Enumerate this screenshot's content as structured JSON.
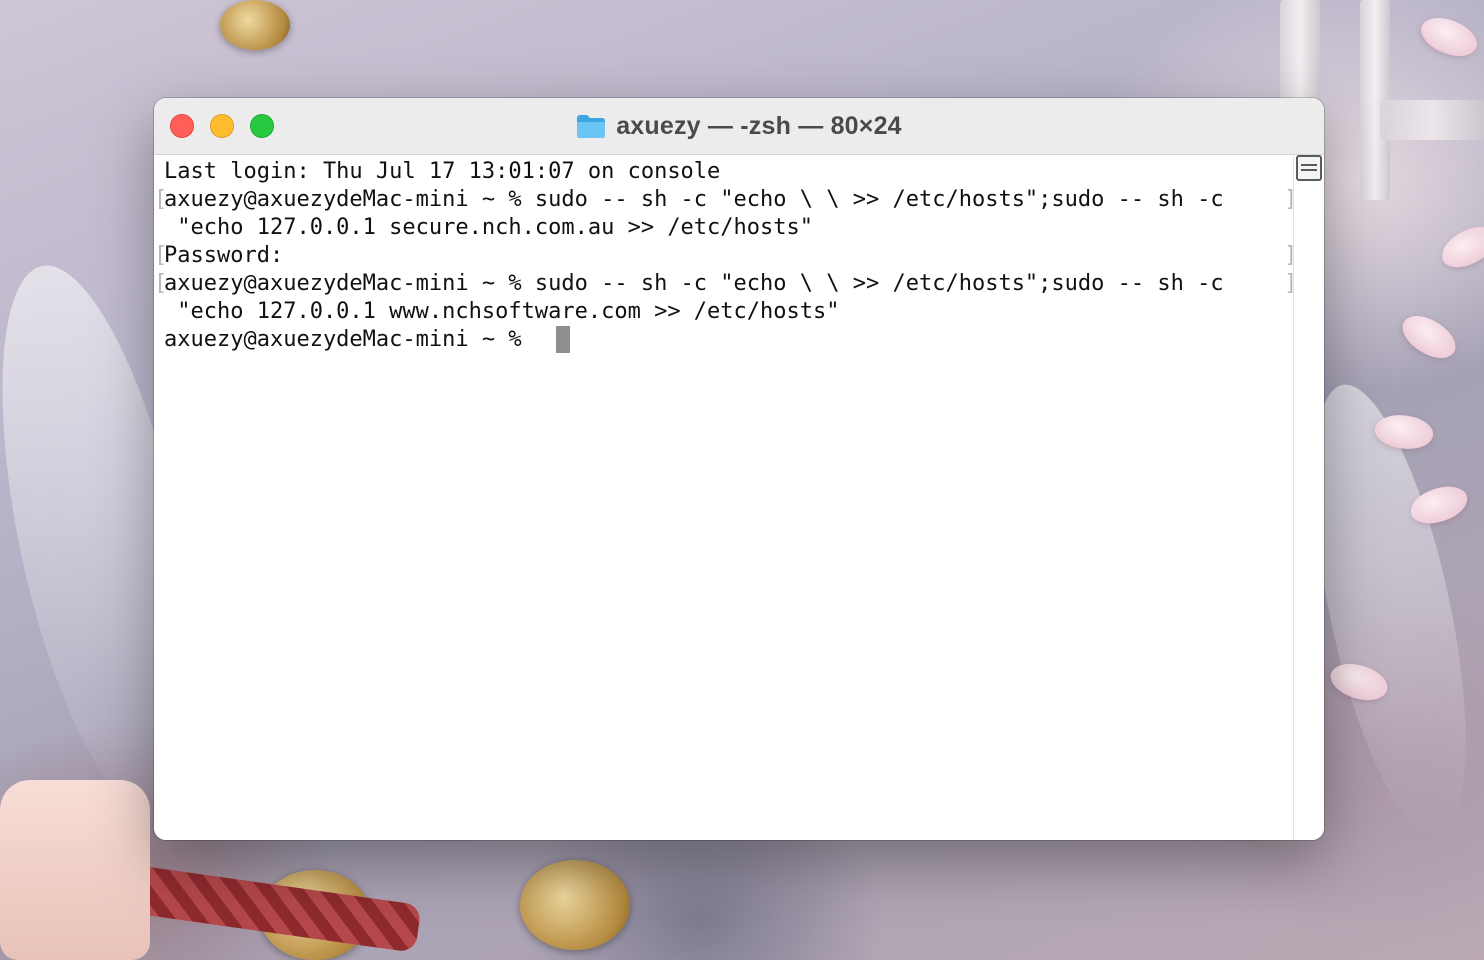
{
  "window": {
    "title": "axuezy — -zsh — 80×24",
    "folder_icon": "folder-icon"
  },
  "terminal": {
    "lines": [
      "Last login: Thu Jul 17 13:01:07 on console",
      "axuezy@axuezydeMac-mini ~ % sudo -- sh -c \"echo \\ \\ >> /etc/hosts\";sudo -- sh -c",
      " \"echo 127.0.0.1 secure.nch.com.au >> /etc/hosts\"",
      "Password:",
      "axuezy@axuezydeMac-mini ~ % sudo -- sh -c \"echo \\ \\ >> /etc/hosts\";sudo -- sh -c",
      " \"echo 127.0.0.1 www.nchsoftware.com >> /etc/hosts\"",
      "axuezy@axuezydeMac-mini ~ % "
    ],
    "bracket_open": "[",
    "bracket_close": "]"
  },
  "colors": {
    "close": "#ff5f57",
    "minimize": "#febc2e",
    "zoom": "#28c840",
    "folder": "#4fb3f0"
  }
}
